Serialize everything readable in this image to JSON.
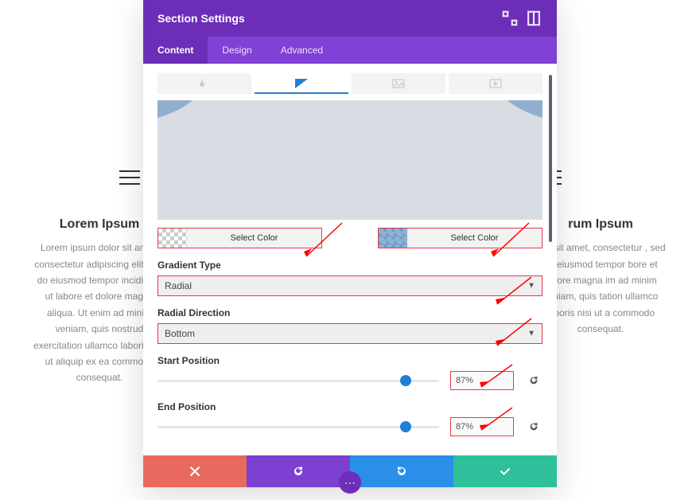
{
  "bg": {
    "heading": "Lorem Ipsum",
    "heading_right": "rum Ipsum",
    "text": "Lorem ipsum dolor sit amet, consectetur adipiscing elit, sed do eiusmod tempor incididunt ut labore et dolore magna aliqua. Ut enim ad minim veniam, quis nostrud exercitation ullamco laboris nisi ut aliquip ex ea commodo consequat.",
    "text_right": "olor sit amet, consectetur , sed do eiusmod tempor bore et dolore magna im ad minim veniam, quis tation ullamco laboris nisi ut a commodo consequat."
  },
  "modal": {
    "title": "Section Settings",
    "tabs": {
      "content": "Content",
      "design": "Design",
      "advanced": "Advanced"
    }
  },
  "colorpicker": {
    "left_label": "Select Color",
    "right_label": "Select Color"
  },
  "fields": {
    "gradient_type": {
      "label": "Gradient Type",
      "value": "Radial"
    },
    "radial_direction": {
      "label": "Radial Direction",
      "value": "Bottom"
    },
    "start_position": {
      "label": "Start Position",
      "value": "87%",
      "pos": 88
    },
    "end_position": {
      "label": "End Position",
      "value": "87%",
      "pos": 88
    }
  }
}
